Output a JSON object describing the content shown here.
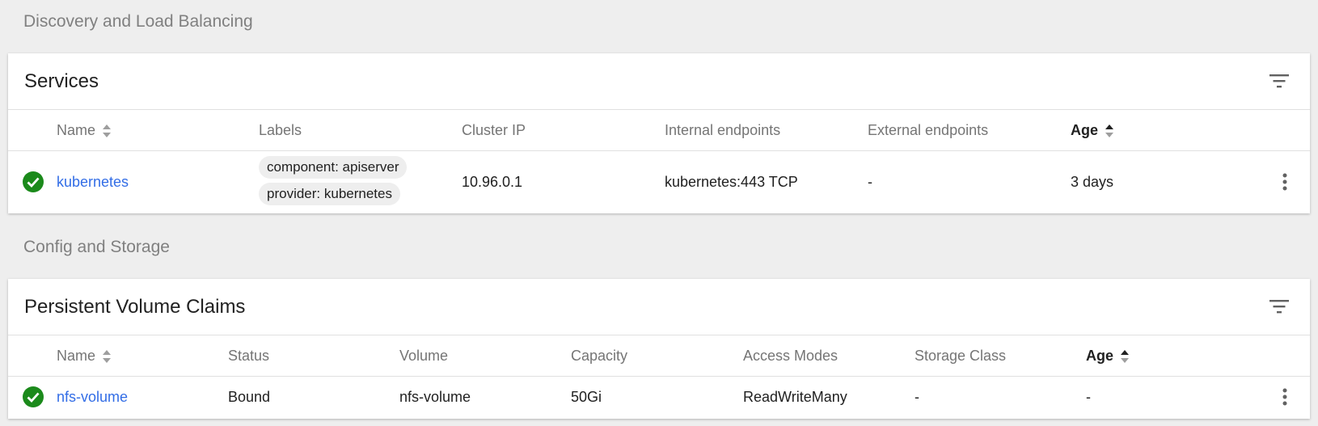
{
  "sections": {
    "discovery_title": "Discovery and Load Balancing",
    "config_title": "Config and Storage"
  },
  "services": {
    "title": "Services",
    "columns": {
      "name": "Name",
      "labels": "Labels",
      "cluster_ip": "Cluster IP",
      "internal_endpoints": "Internal endpoints",
      "external_endpoints": "External endpoints",
      "age": "Age"
    },
    "rows": [
      {
        "status": "success",
        "name": "kubernetes",
        "labels": [
          "component: apiserver",
          "provider: kubernetes"
        ],
        "cluster_ip": "10.96.0.1",
        "internal_endpoints": "kubernetes:443 TCP",
        "external_endpoints": "-",
        "age": "3 days"
      }
    ]
  },
  "pvc": {
    "title": "Persistent Volume Claims",
    "columns": {
      "name": "Name",
      "status": "Status",
      "volume": "Volume",
      "capacity": "Capacity",
      "access_modes": "Access Modes",
      "storage_class": "Storage Class",
      "age": "Age"
    },
    "rows": [
      {
        "status_icon": "success",
        "name": "nfs-volume",
        "status": "Bound",
        "volume": "nfs-volume",
        "capacity": "50Gi",
        "access_modes": "ReadWriteMany",
        "storage_class": "-",
        "age": "-"
      }
    ]
  },
  "colors": {
    "link": "#326de6",
    "success": "#1b8a1b",
    "background": "#eeeeee"
  },
  "icons": {
    "filter": "filter-icon",
    "sort": "sort-icon",
    "status": "check-circle-icon",
    "menu": "more-vert-icon"
  }
}
